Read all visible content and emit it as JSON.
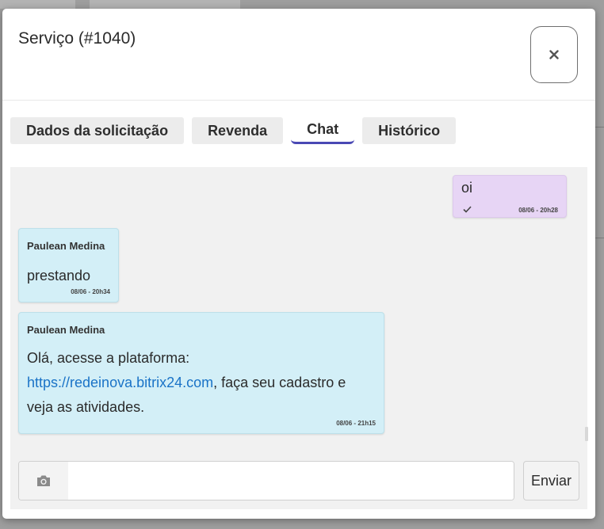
{
  "modal": {
    "title": "Serviço (#1040)",
    "close_icon": "close-icon"
  },
  "tabs": [
    {
      "label": "Dados da solicitação",
      "active": false
    },
    {
      "label": "Revenda",
      "active": false
    },
    {
      "label": "Chat",
      "active": true
    },
    {
      "label": "Histórico",
      "active": false
    }
  ],
  "messages": [
    {
      "own": true,
      "author": "",
      "text": "oi",
      "time": "08/06 - 20h28",
      "status_icon": "check-icon"
    },
    {
      "own": false,
      "author": "Paulean Medina",
      "text": "prestando",
      "time": "08/06 - 20h34"
    },
    {
      "own": false,
      "author": "Paulean Medina",
      "text_before": "Olá, acesse a plataforma:",
      "link": "https://redeinova.bitrix24.com",
      "text_after": ", faça seu cadastro e",
      "text_last": "veja as atividades.",
      "time": "08/06 - 21h15"
    }
  ],
  "composer": {
    "camera_icon": "camera-icon",
    "input_value": "",
    "input_placeholder": "",
    "send_label": "Enviar"
  },
  "colors": {
    "accent": "#4a49b4",
    "own_bubble": "#e7d5f5",
    "other_bubble": "#d3eff7",
    "link": "#1a73c7"
  }
}
